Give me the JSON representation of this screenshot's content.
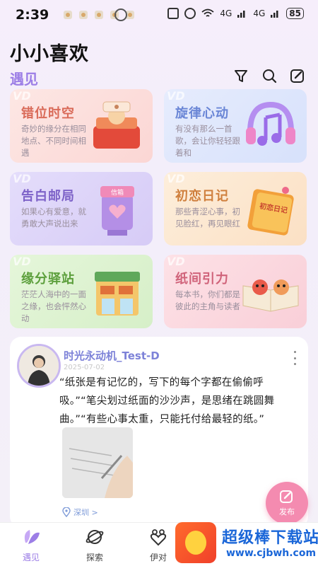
{
  "status_bar": {
    "time": "2:39",
    "network_1": "4G",
    "network_2": "4G",
    "battery": "85"
  },
  "app": {
    "title": "小小喜欢",
    "section": "遇见"
  },
  "cards": [
    {
      "title": "错位时空",
      "desc": "奇妙的缘分在相同地点、不同时间相遇",
      "badge": "VD"
    },
    {
      "title": "旋律心动",
      "desc": "有没有那么一首歌，会让你轻轻跟着和",
      "badge": "VD"
    },
    {
      "title": "告白邮局",
      "desc": "如果心有爱意，就勇敢大声说出来",
      "badge": "VD"
    },
    {
      "title": "初恋日记",
      "desc": "那些青涩心事，初见脸红，再见眼红",
      "badge": "VD"
    },
    {
      "title": "缘分驿站",
      "desc": "茫茫人海中的一面之缘，也会怦然心动",
      "badge": "VD"
    },
    {
      "title": "纸间引力",
      "desc": "每本书，你们都是彼此的主角与读者",
      "badge": "VD"
    }
  ],
  "card_art_labels": {
    "mailbox": "信箱",
    "diary": "初恋日记"
  },
  "post": {
    "author": "时光永动机_Test-D",
    "date": "2025-07-02",
    "text": "“纸张是有记忆的，写下的每个字都在偷偷呼吸。”“笔尖划过纸面的沙沙声，是思绪在跳圆舞曲。”“有些心事太重，只能托付给最轻的纸。”",
    "location": "深圳 >"
  },
  "fab": {
    "label": "发布"
  },
  "bottom_nav": [
    {
      "label": "遇见",
      "icon": "meet-icon",
      "active": true
    },
    {
      "label": "探索",
      "icon": "planet-icon",
      "active": false
    },
    {
      "label": "伊对",
      "icon": "couple-icon",
      "active": false
    }
  ],
  "watermark": {
    "text": "超级棒下载站",
    "url": "www.cjbwh.com"
  },
  "colors": {
    "accent": "#9c7ee6",
    "fab": "#f48bb0",
    "name": "#7d82d8"
  }
}
